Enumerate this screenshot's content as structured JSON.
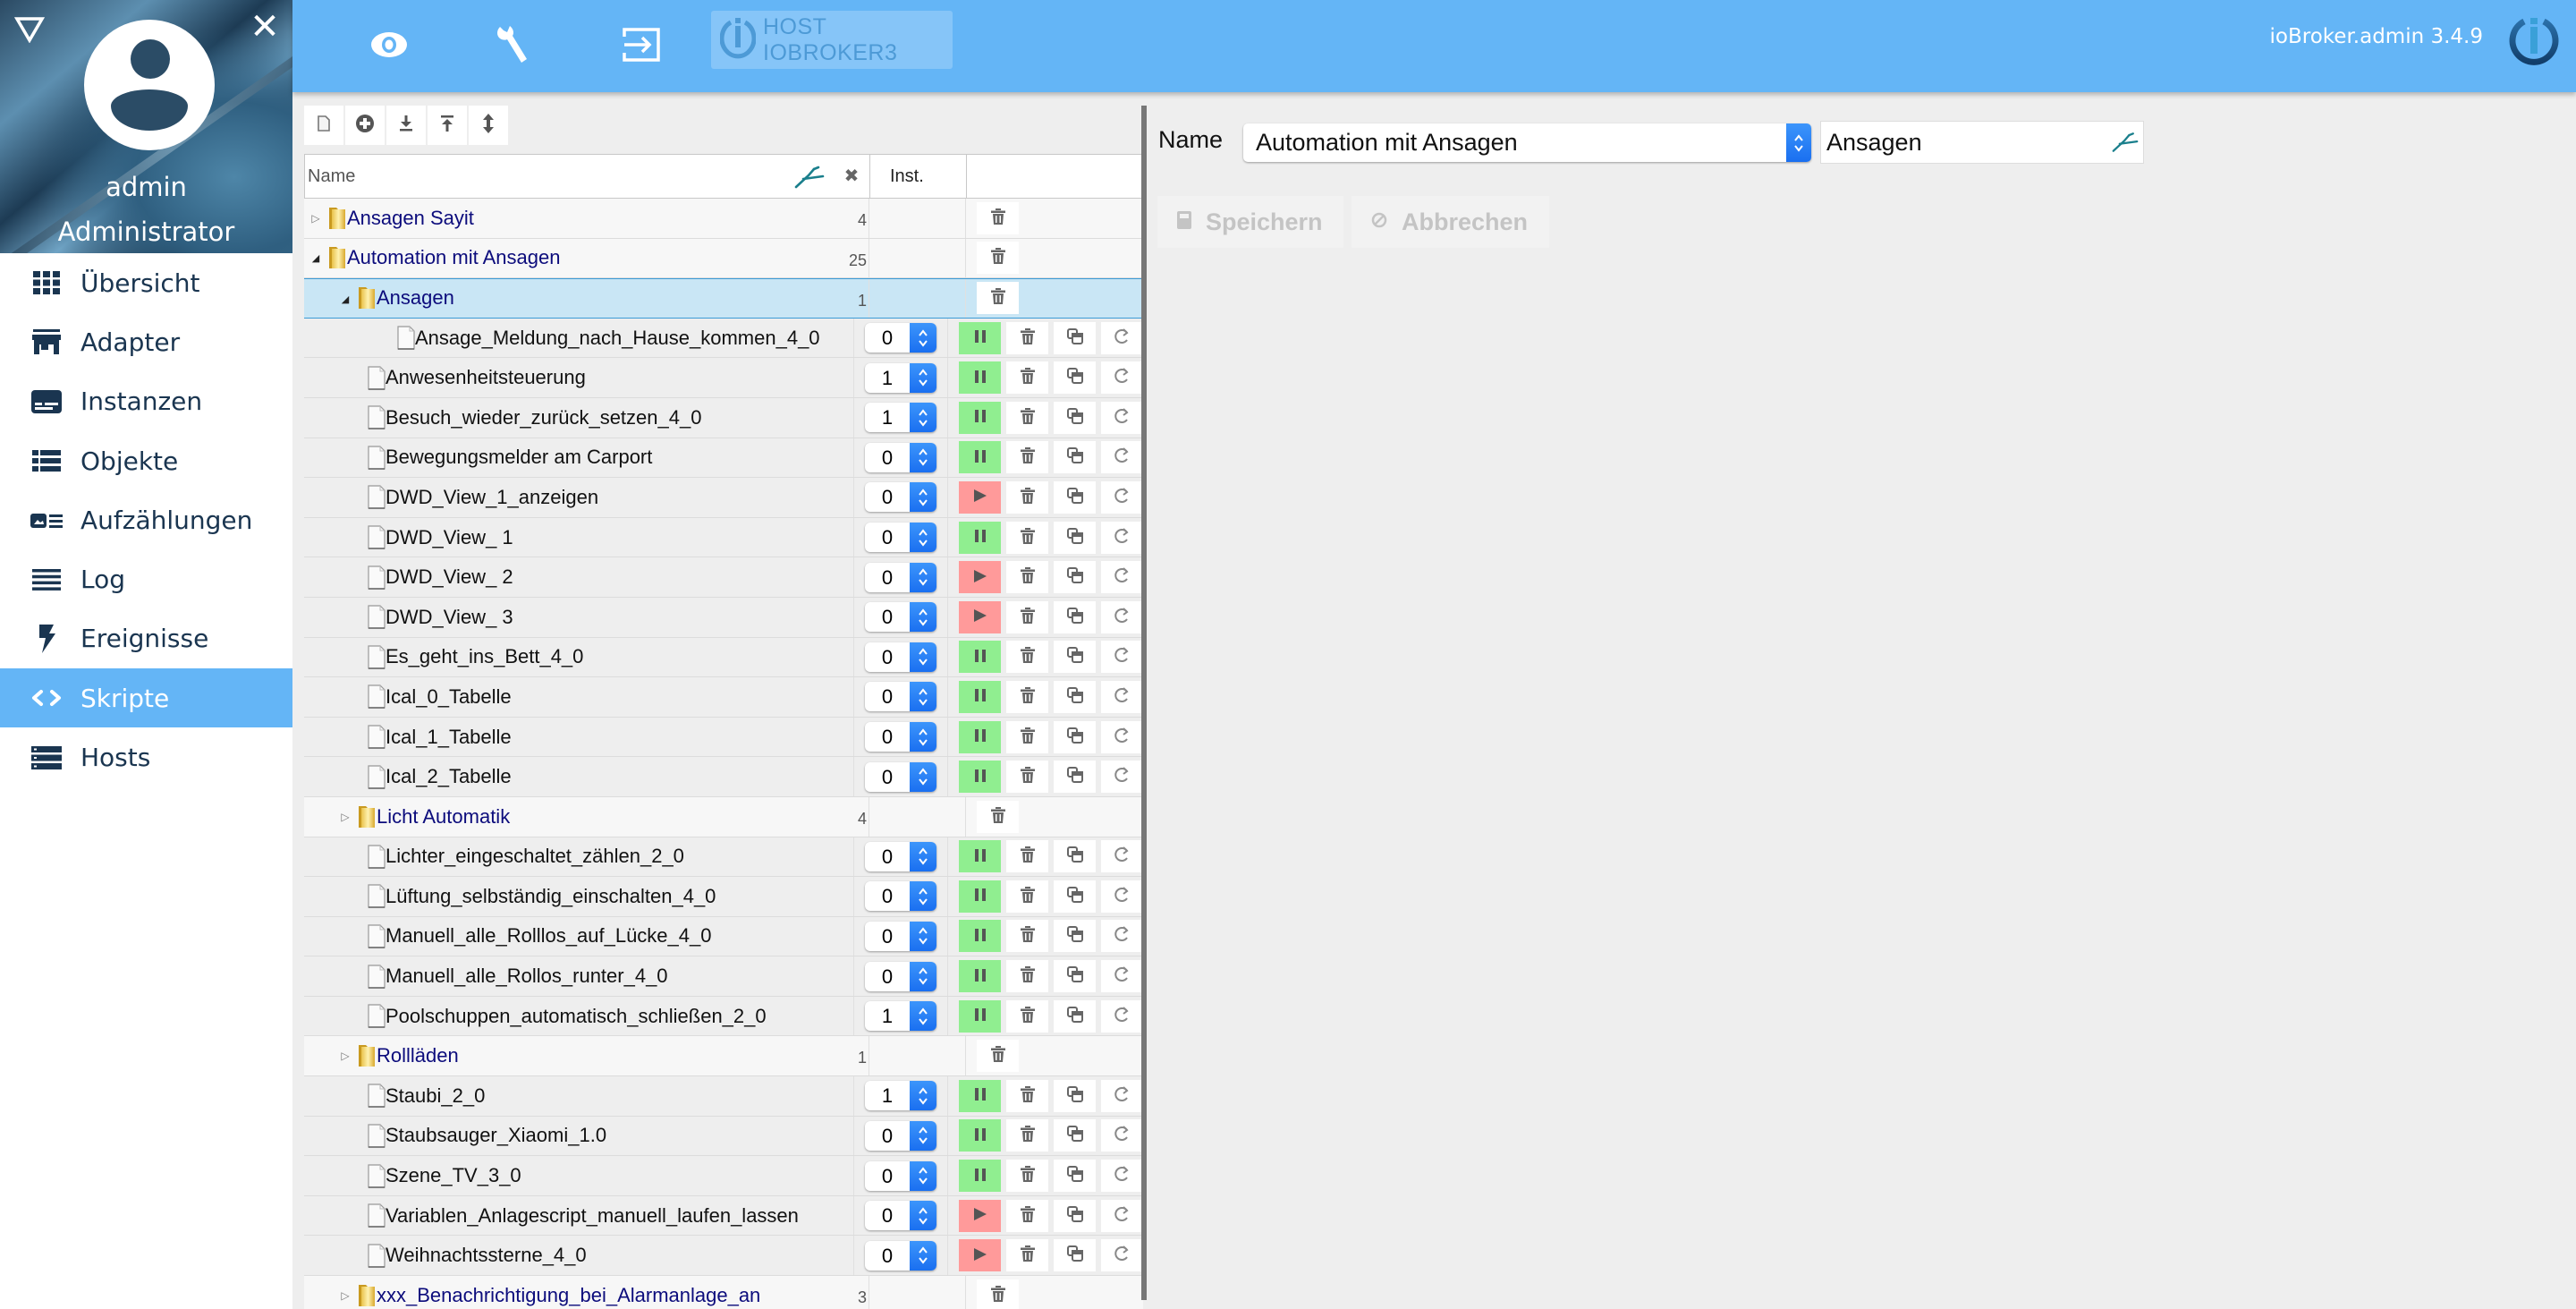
{
  "sidebar": {
    "user": {
      "name": "admin",
      "role": "Administrator"
    },
    "menu_toggle_icon": "triangle-down-icon",
    "close_icon": "close-icon",
    "close_glyph": "✕",
    "items": [
      {
        "label": "Übersicht",
        "icon": "grid-icon",
        "active": false
      },
      {
        "label": "Adapter",
        "icon": "store-icon",
        "active": false
      },
      {
        "label": "Instanzen",
        "icon": "instances-icon",
        "active": false
      },
      {
        "label": "Objekte",
        "icon": "list-icon",
        "active": false
      },
      {
        "label": "Aufzählungen",
        "icon": "enum-icon",
        "active": false
      },
      {
        "label": "Log",
        "icon": "log-icon",
        "active": false
      },
      {
        "label": "Ereignisse",
        "icon": "lightning-icon",
        "active": false
      },
      {
        "label": "Skripte",
        "icon": "code-icon",
        "active": true
      },
      {
        "label": "Hosts",
        "icon": "server-icon",
        "active": false
      }
    ]
  },
  "topbar": {
    "icons": [
      "eye-icon",
      "wrench-icon",
      "logout-icon"
    ],
    "host_label": "HOST IOBROKER3",
    "version": "ioBroker.admin 3.4.9"
  },
  "tree": {
    "toolbar": [
      "new-script-icon",
      "add-folder-icon",
      "import-icon",
      "export-icon",
      "expand-collapse-icon"
    ],
    "columns": {
      "name": "Name",
      "instance": "Inst."
    },
    "clear_glyph": "✖",
    "rows": [
      {
        "type": "folder",
        "name": "Ansagen Sayit",
        "level": 0,
        "expanded": false,
        "count": "4",
        "selected": false
      },
      {
        "type": "folder",
        "name": "Automation mit Ansagen",
        "level": 0,
        "expanded": true,
        "count": "25",
        "selected": false
      },
      {
        "type": "folder",
        "name": "Ansagen",
        "level": 1,
        "expanded": true,
        "count": "1",
        "selected": true
      },
      {
        "type": "script",
        "name": "Ansage_Meldung_nach_Hause_kommen_4_0",
        "level": 2,
        "instance": "0",
        "state": "running"
      },
      {
        "type": "script",
        "name": "Anwesenheitsteuerung",
        "level": 1,
        "instance": "1",
        "state": "running"
      },
      {
        "type": "script",
        "name": "Besuch_wieder_zurück_setzen_4_0",
        "level": 1,
        "instance": "1",
        "state": "running"
      },
      {
        "type": "script",
        "name": "Bewegungsmelder am Carport",
        "level": 1,
        "instance": "0",
        "state": "running"
      },
      {
        "type": "script",
        "name": "DWD_View_1_anzeigen",
        "level": 1,
        "instance": "0",
        "state": "stopped"
      },
      {
        "type": "script",
        "name": "DWD_View_ 1",
        "level": 1,
        "instance": "0",
        "state": "running"
      },
      {
        "type": "script",
        "name": "DWD_View_ 2",
        "level": 1,
        "instance": "0",
        "state": "stopped"
      },
      {
        "type": "script",
        "name": "DWD_View_ 3",
        "level": 1,
        "instance": "0",
        "state": "stopped"
      },
      {
        "type": "script",
        "name": "Es_geht_ins_Bett_4_0",
        "level": 1,
        "instance": "0",
        "state": "running"
      },
      {
        "type": "script",
        "name": "Ical_0_Tabelle",
        "level": 1,
        "instance": "0",
        "state": "running"
      },
      {
        "type": "script",
        "name": "Ical_1_Tabelle",
        "level": 1,
        "instance": "0",
        "state": "running"
      },
      {
        "type": "script",
        "name": "Ical_2_Tabelle",
        "level": 1,
        "instance": "0",
        "state": "running"
      },
      {
        "type": "folder",
        "name": "Licht Automatik",
        "level": 1,
        "expanded": false,
        "count": "4",
        "selected": false
      },
      {
        "type": "script",
        "name": "Lichter_eingeschaltet_zählen_2_0",
        "level": 1,
        "instance": "0",
        "state": "running"
      },
      {
        "type": "script",
        "name": "Lüftung_selbständig_einschalten_4_0",
        "level": 1,
        "instance": "0",
        "state": "running"
      },
      {
        "type": "script",
        "name": "Manuell_alle_Rolllos_auf_Lücke_4_0",
        "level": 1,
        "instance": "0",
        "state": "running"
      },
      {
        "type": "script",
        "name": "Manuell_alle_Rollos_runter_4_0",
        "level": 1,
        "instance": "0",
        "state": "running"
      },
      {
        "type": "script",
        "name": "Poolschuppen_automatisch_schließen_2_0",
        "level": 1,
        "instance": "1",
        "state": "running"
      },
      {
        "type": "folder",
        "name": "Rollläden",
        "level": 1,
        "expanded": false,
        "count": "1",
        "selected": false
      },
      {
        "type": "script",
        "name": "Staubi_2_0",
        "level": 1,
        "instance": "1",
        "state": "running"
      },
      {
        "type": "script",
        "name": "Staubsauger_Xiaomi_1.0",
        "level": 1,
        "instance": "0",
        "state": "running"
      },
      {
        "type": "script",
        "name": "Szene_TV_3_0",
        "level": 1,
        "instance": "0",
        "state": "running"
      },
      {
        "type": "script",
        "name": "Variablen_Anlagescript_manuell_laufen_lassen",
        "level": 1,
        "instance": "0",
        "state": "stopped"
      },
      {
        "type": "script",
        "name": "Weihnachtssterne_4_0",
        "level": 1,
        "instance": "0",
        "state": "stopped"
      },
      {
        "type": "folder",
        "name": "xxx_Benachrichtigung_bei_Alarmanlage_an",
        "level": 1,
        "expanded": false,
        "count": "3",
        "selected": false
      }
    ]
  },
  "editor": {
    "name_label": "Name",
    "folder_value": "Automation mit Ansagen",
    "name_value": "Ansagen",
    "save_label": "Speichern",
    "cancel_label": "Abbrechen"
  },
  "colors": {
    "accent": "#64b5f6",
    "menu_text": "#1a3550",
    "running": "#90ee90",
    "stopped": "#ff9a9a",
    "folder_text": "#0c0c7c",
    "selected_row": "#c9e6f5"
  }
}
